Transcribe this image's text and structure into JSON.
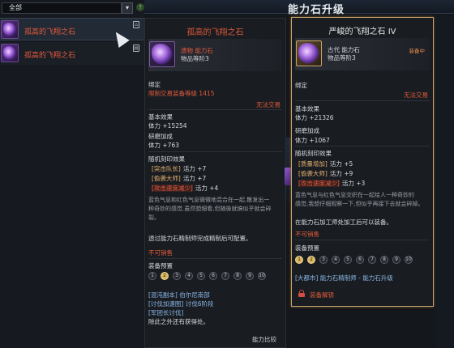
{
  "header": {
    "title": "能力石升级"
  },
  "filter": {
    "value": "全部",
    "arrow": "▾",
    "help": "?"
  },
  "list": {
    "items": [
      {
        "name": "孤高的飞翔之石",
        "tag": "⌂"
      },
      {
        "name": "孤高的飞翔之石",
        "tag": "▤"
      }
    ]
  },
  "left_card": {
    "title": "孤高的飞翔之石",
    "grade": "遗物 能力石",
    "tier": "物品等阶3",
    "bind_label": "绑定",
    "bind_req": "限制交易装备等级 1415",
    "trade": "无法交易",
    "base_label": "基本效果",
    "base_value": "体力 +15254",
    "polish_label": "研磨加成",
    "polish_value": "体力 +763",
    "engrave_label": "随机刻印效果",
    "engraves": [
      {
        "name": "[突击队长]",
        "value": "活力 +7"
      },
      {
        "name": "[偷袭大师]",
        "value": "活力 +7"
      },
      {
        "name": "[攻击速度减少]",
        "value": "活力 +4"
      }
    ],
    "desc1": "蓝色气息和红色气息微微地混合在一起,散发出一",
    "desc2": "种奇妙的感觉.虽然想细看,但随後就搞似乎就会碎",
    "desc3": "裂。",
    "craft_note": "透过能力石精制师完成精制后可配置。",
    "not_sellable": "不可销售",
    "preset_label": "装备预置",
    "presets": [
      "1",
      "2",
      "3",
      "4",
      "5",
      "6",
      "7",
      "8",
      "9",
      "10"
    ],
    "source1": "[混沌副本] 伯尔尼南部",
    "source2": "[讨伐加速图] 讨伐6阶段",
    "source3": "[军团长讨伐]",
    "source4": "除此之外还有获得处。",
    "compare": "能力比较"
  },
  "right_card": {
    "title": "严峻的飞翔之石 IV",
    "grade": "古代 能力石",
    "tier": "物品等阶3",
    "equip_status": "装备中",
    "bind_label": "绑定",
    "trade": "无法交易",
    "base_label": "基本效果",
    "base_value": "体力 +21326",
    "polish_label": "研磨加成",
    "polish_value": "体力 +1067",
    "engrave_label": "随机刻印效果",
    "engraves": [
      {
        "name": "[质量增加]",
        "value": "活力 +5"
      },
      {
        "name": "[偷袭大师]",
        "value": "活力 +9"
      },
      {
        "name": "[攻击速度减少]",
        "value": "活力 +3"
      }
    ],
    "desc1": "蓝色气息与红色气息交织在一起给人一种奇妙的",
    "desc2": "感觉,我想仔细观察一下,但似乎再接下去就会碎掉。",
    "craft_note": "在能力石加工师处加工后可以装备。",
    "not_sellable": "不可销售",
    "preset_label": "装备预置",
    "presets": [
      "1",
      "2",
      "3",
      "4",
      "5",
      "6",
      "7",
      "8",
      "9",
      "10"
    ],
    "source": "[大都市] 能力石精制师 - 能力石升级",
    "locked": "装备解锁"
  }
}
